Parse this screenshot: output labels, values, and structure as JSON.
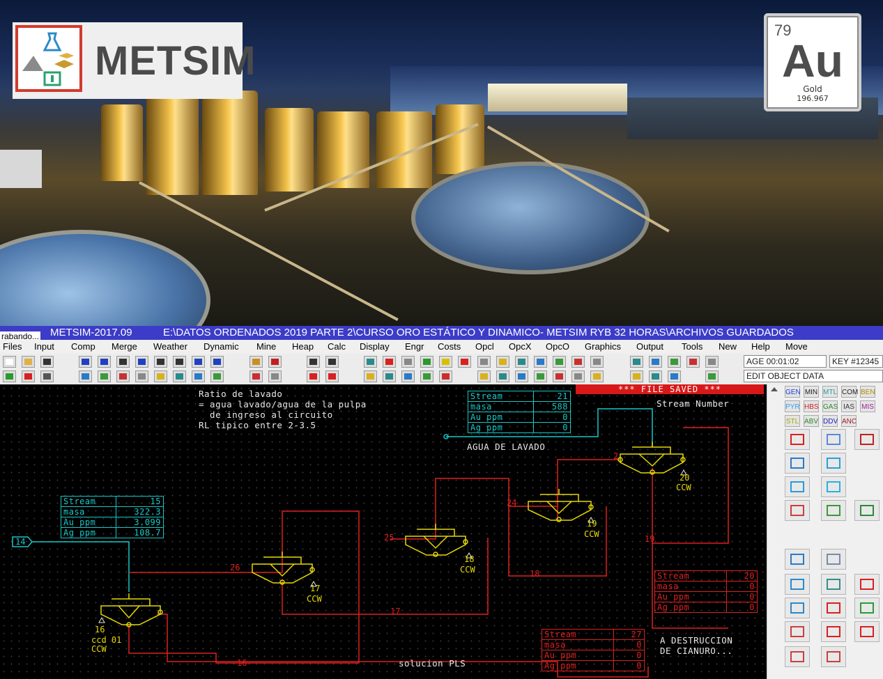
{
  "banner": {
    "logo_text": "METSIM",
    "element": {
      "number": "79",
      "symbol": "Au",
      "name": "Gold",
      "weight": "196.967"
    }
  },
  "window": {
    "recording_label": "rabando...",
    "app_title": "METSIM-2017.09",
    "path": "E:\\DATOS ORDENADOS 2019 PARTE 2\\CURSO ORO ESTÁTICO  Y DINAMICO- METSIM RYB 32 HORAS\\ARCHIVOS GUARDADOS"
  },
  "menu": [
    "Files",
    "Input",
    "Comp",
    "Merge",
    "Weather",
    "Dynamic",
    "Mine",
    "Heap",
    "Calc",
    "Display",
    "Engr",
    "Costs",
    "Opcl",
    "OpcX",
    "OpcO",
    "Graphics",
    "Output",
    "Tools",
    "New",
    "Help",
    "Move"
  ],
  "status": {
    "age": "AGE 00:01:02",
    "key": "KEY #12345",
    "mode": "EDIT OBJECT DATA"
  },
  "toolbar_icons": [
    "new-file-icon",
    "open-folder-icon",
    "save-icon",
    "run-icon",
    "check-icon",
    "print-icon",
    "stream-icon",
    "split-icon",
    "node-icon",
    "select-icon",
    "arrow-icon",
    "line-icon",
    "pointer-icon",
    "zoom-icon",
    "undo-icon",
    "redo-icon",
    "copy-icon",
    "delete-icon",
    "move-left-icon",
    "move-right-icon",
    "graph-icon",
    "stop-icon",
    "layer-icon",
    "calc-icon",
    "info-icon",
    "exit-icon"
  ],
  "canvas": {
    "saved_banner": "*** FILE SAVED ***",
    "stream_number_label": "Stream Number",
    "note": [
      "Ratio de lavado",
      "= agua lavado/agua de la pulpa",
      "  de ingreso al circuito",
      "RL tipico entre 2-3.5"
    ],
    "agua_label": "AGUA DE LAVADO",
    "pls_label": "solucion PLS",
    "destruccion_label": [
      "A DESTRUCCION",
      "DE CIANURO..."
    ],
    "feed_stream": "14",
    "stream_labels": [
      "26",
      "25",
      "24",
      "2",
      "17",
      "18",
      "19",
      "16"
    ],
    "units": [
      {
        "id": "16",
        "name": "ccd 01",
        "type": "CCW"
      },
      {
        "id": "17",
        "name": "",
        "type": "CCW"
      },
      {
        "id": "18",
        "name": "",
        "type": "CCW"
      },
      {
        "id": "19",
        "name": "",
        "type": "CCW"
      },
      {
        "id": "20",
        "name": "",
        "type": "CCW"
      }
    ],
    "tables": {
      "s15": {
        "rows": [
          [
            "Stream",
            "15"
          ],
          [
            "masa",
            "322.3"
          ],
          [
            "Au ppm",
            "3.099"
          ],
          [
            "Ag ppm",
            "108.7"
          ]
        ]
      },
      "s21": {
        "rows": [
          [
            "Stream",
            "21"
          ],
          [
            "masa",
            "588"
          ],
          [
            "Au ppm",
            "0"
          ],
          [
            "Ag ppm",
            "0"
          ]
        ]
      },
      "s20": {
        "rows": [
          [
            "Stream",
            "20"
          ],
          [
            "masa",
            "0"
          ],
          [
            "Au ppm",
            "0"
          ],
          [
            "Ag ppm",
            "0"
          ]
        ]
      },
      "s27": {
        "rows": [
          [
            "Stream",
            "27"
          ],
          [
            "masa",
            "0"
          ],
          [
            "Au ppm",
            "0"
          ],
          [
            "Ag ppm",
            "0"
          ]
        ]
      }
    }
  },
  "palette": {
    "tags": [
      "GEN",
      "MIN",
      "MTL",
      "COM",
      "BEN",
      "PYR",
      "HBS",
      "GAS",
      "IAS",
      "MIS",
      "STL",
      "ABV",
      "DDV",
      "ANC"
    ],
    "tag_colors": [
      "#1a3bd8",
      "#222222",
      "#2a9a9a",
      "#222222",
      "#b08a00",
      "#2aa0ff",
      "#d22020",
      "#2a8a2a",
      "#333333",
      "#a020a0",
      "#a8a800",
      "#2a8a2a",
      "#2020c0",
      "#a02020"
    ]
  }
}
